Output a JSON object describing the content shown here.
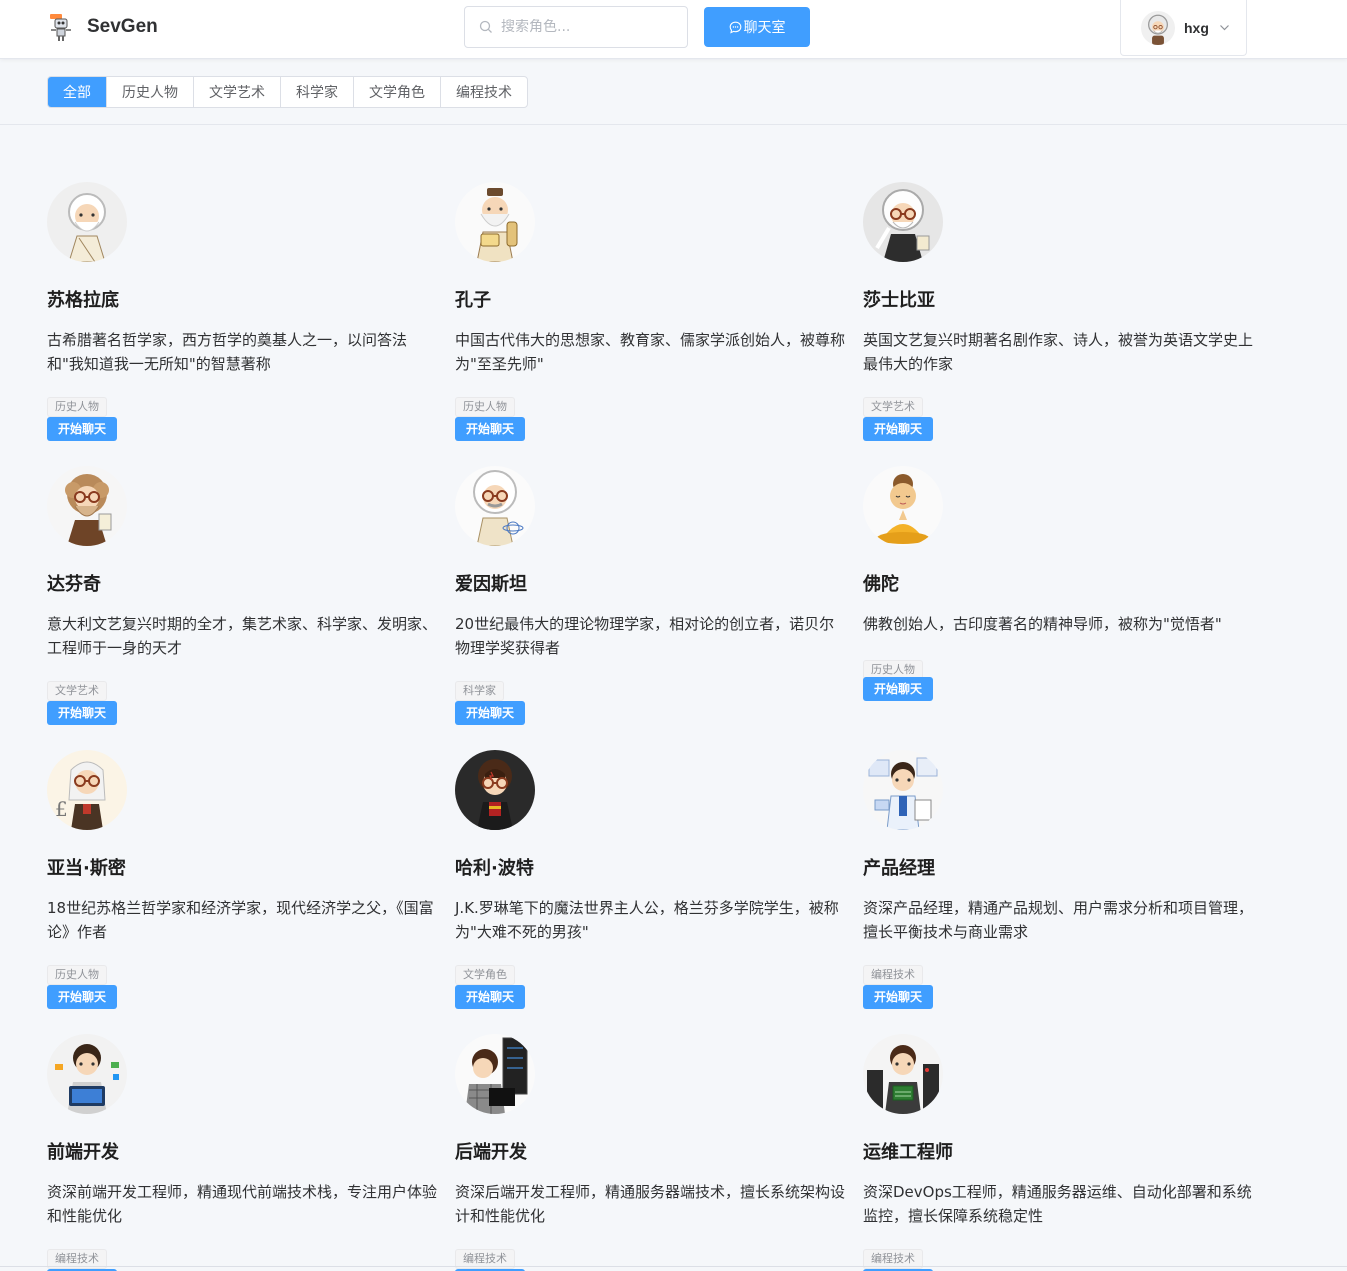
{
  "header": {
    "logo_text": "SevGen",
    "search_placeholder": "搜索角色...",
    "chat_button_label": "聊天室",
    "username": "hxg"
  },
  "filters": [
    "全部",
    "历史人物",
    "文学艺术",
    "科学家",
    "文学角色",
    "编程技术"
  ],
  "active_filter": "全部",
  "start_chat_label": "开始聊天",
  "characters": [
    {
      "name": "苏格拉底",
      "desc": "古希腊著名哲学家，西方哲学的奠基人之一，以问答法和\"我知道我一无所知\"的智慧著称",
      "tag": "历史人物",
      "avatar": "elder-toga"
    },
    {
      "name": "孔子",
      "desc": "中国古代伟大的思想家、教育家、儒家学派创始人，被尊称为\"至圣先师\"",
      "tag": "历史人物",
      "avatar": "elder-scroll"
    },
    {
      "name": "莎士比亚",
      "desc": "英国文艺复兴时期著名剧作家、诗人，被誉为英语文学史上最伟大的作家",
      "tag": "文学艺术",
      "avatar": "elder-quill"
    },
    {
      "name": "达芬奇",
      "desc": "意大利文艺复兴时期的全才，集艺术家、科学家、发明家、工程师于一身的天才",
      "tag": "文学艺术",
      "avatar": "curly-elder"
    },
    {
      "name": "爱因斯坦",
      "desc": "20世纪最伟大的理论物理学家，相对论的创立者，诺贝尔物理学奖获得者",
      "tag": "科学家",
      "avatar": "scientist"
    },
    {
      "name": "佛陀",
      "desc": "佛教创始人，古印度著名的精神导师，被称为\"觉悟者\"",
      "tag": "历史人物",
      "avatar": "buddha"
    },
    {
      "name": "亚当·斯密",
      "desc": "18世纪苏格兰哲学家和经济学家，现代经济学之父，《国富论》作者",
      "tag": "历史人物",
      "avatar": "economist"
    },
    {
      "name": "哈利·波特",
      "desc": "J.K.罗琳笔下的魔法世界主人公，格兰芬多学院学生，被称为\"大难不死的男孩\"",
      "tag": "文学角色",
      "avatar": "wizard-boy"
    },
    {
      "name": "产品经理",
      "desc": "资深产品经理，精通产品规划、用户需求分析和项目管理，擅长平衡技术与商业需求",
      "tag": "编程技术",
      "avatar": "pm"
    },
    {
      "name": "前端开发",
      "desc": "资深前端开发工程师，精通现代前端技术栈，专注用户体验和性能优化",
      "tag": "编程技术",
      "avatar": "frontend"
    },
    {
      "name": "后端开发",
      "desc": "资深后端开发工程师，精通服务器端技术，擅长系统架构设计和性能优化",
      "tag": "编程技术",
      "avatar": "backend"
    },
    {
      "name": "运维工程师",
      "desc": "资深DevOps工程师，精通服务器运维、自动化部署和系统监控，擅长保障系统稳定性",
      "tag": "编程技术",
      "avatar": "devops"
    }
  ]
}
